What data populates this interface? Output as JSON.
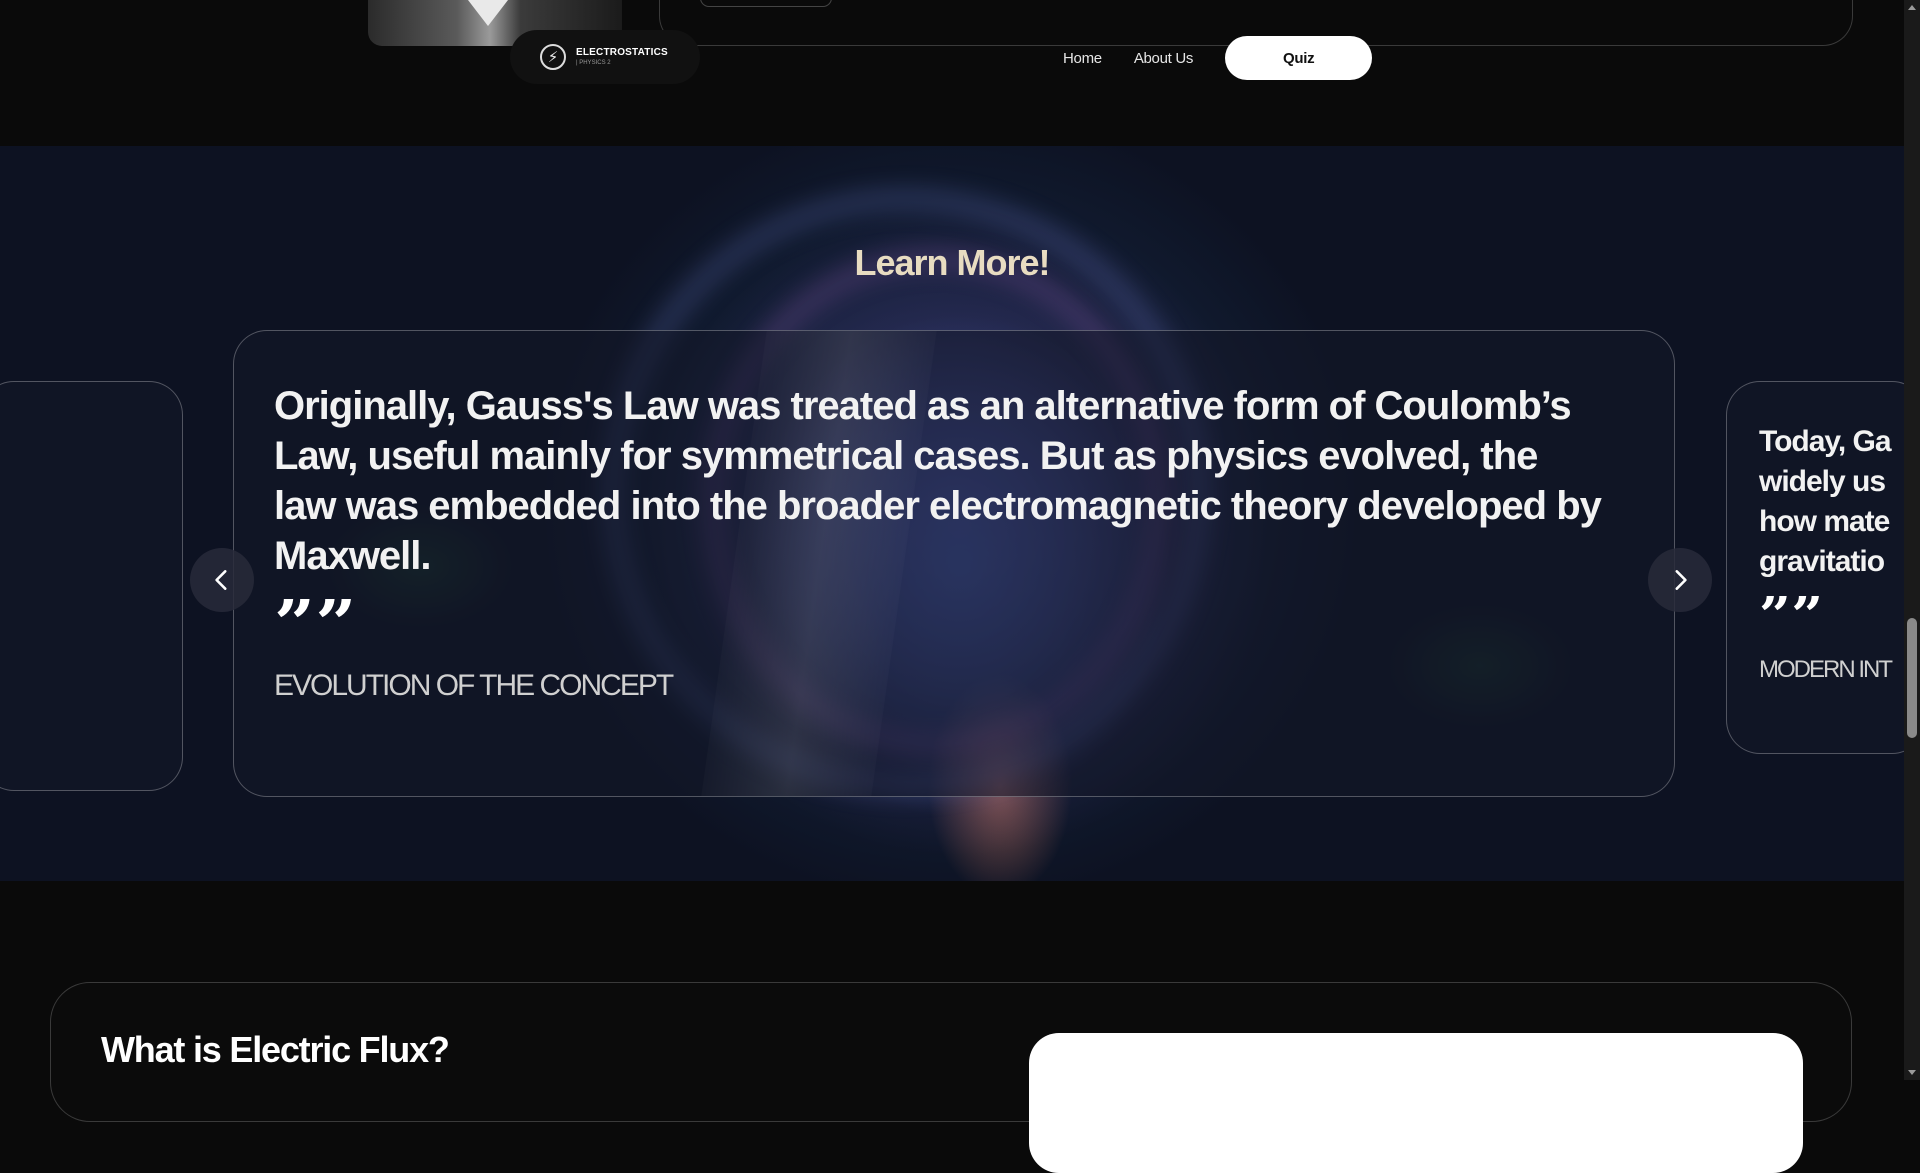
{
  "brand": {
    "title": "ELECTROSTATICS",
    "subtitle": "| PHYSICS 2",
    "icon": "lightning-bolt-icon"
  },
  "nav": {
    "links": [
      "Home",
      "About Us"
    ],
    "cta": "Quiz"
  },
  "learn_more": {
    "heading": "Learn More!",
    "slides": [
      {
        "quote": "Originally, Gauss's Law was treated as an alternative form of Coulomb’s Law, useful mainly for symmetrical cases. But as physics evolved, the law was embedded into the broader electromagnetic theory developed by Maxwell.",
        "label": "EVOLUTION OF THE CONCEPT"
      },
      {
        "quote_lines": [
          "Today, Ga",
          "widely us",
          "how mate",
          "gravitatio"
        ],
        "label": "MODERN INT"
      }
    ],
    "prev_icon": "chevron-left-icon",
    "next_icon": "chevron-right-icon"
  },
  "flux": {
    "heading": "What is Electric Flux?"
  },
  "colors": {
    "accent_heading": "#e8dcc1",
    "background": "#0a0a0a",
    "button": "#ffffff"
  }
}
